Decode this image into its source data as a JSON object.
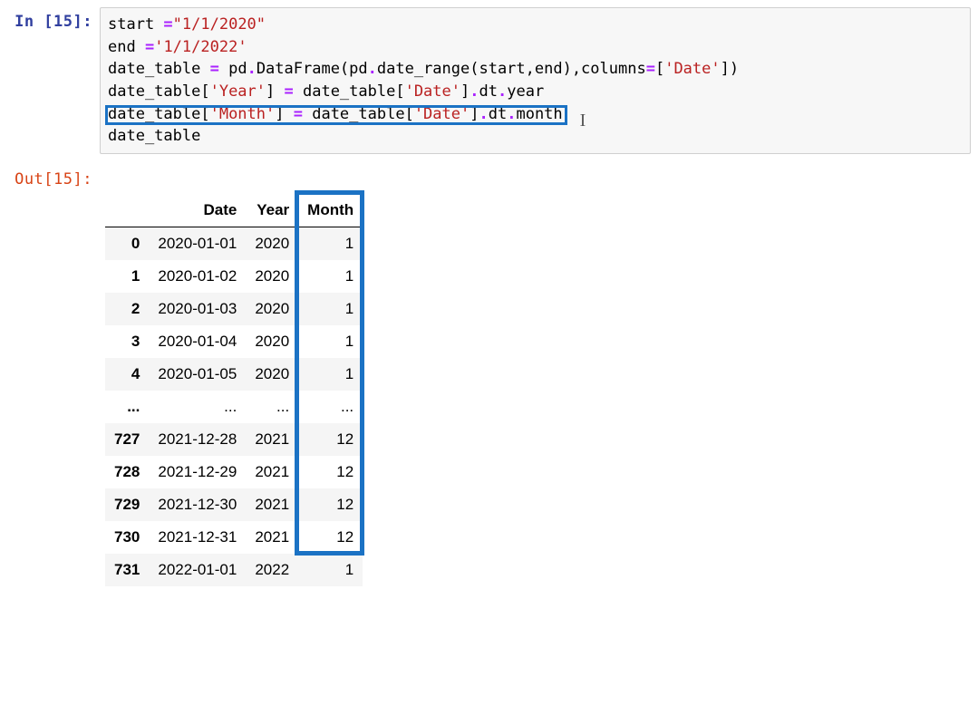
{
  "prompts": {
    "in_label": "In [",
    "in_num": "15",
    "in_close": "]:",
    "out_label": "Out[",
    "out_num": "15",
    "out_close": "]:"
  },
  "code": {
    "l1a": "start ",
    "l1b": "=",
    "l1c": "\"1/1/2020\"",
    "l2a": "end ",
    "l2b": "=",
    "l2c": "'1/1/2022'",
    "l3a": "date_table ",
    "l3b": "=",
    "l3c": " pd",
    "l3d": ".",
    "l3e": "DataFrame(pd",
    "l3f": ".",
    "l3g": "date_range(start,end),columns",
    "l3h": "=",
    "l3i": "[",
    "l3j": "'Date'",
    "l3k": "])",
    "l4a": "date_table[",
    "l4b": "'Year'",
    "l4c": "] ",
    "l4d": "=",
    "l4e": " date_table[",
    "l4f": "'Date'",
    "l4g": "]",
    "l4h": ".",
    "l4i": "dt",
    "l4j": ".",
    "l4k": "year",
    "l5a": "date_table[",
    "l5b": "'Month'",
    "l5c": "] ",
    "l5d": "=",
    "l5e": " date_table[",
    "l5f": "'Date'",
    "l5g": "]",
    "l5h": ".",
    "l5i": "dt",
    "l5j": ".",
    "l5k": "month",
    "l6": "date_table"
  },
  "table": {
    "columns": [
      "Date",
      "Year",
      "Month"
    ],
    "rows": [
      {
        "idx": "0",
        "date": "2020-01-01",
        "year": "2020",
        "month": "1"
      },
      {
        "idx": "1",
        "date": "2020-01-02",
        "year": "2020",
        "month": "1"
      },
      {
        "idx": "2",
        "date": "2020-01-03",
        "year": "2020",
        "month": "1"
      },
      {
        "idx": "3",
        "date": "2020-01-04",
        "year": "2020",
        "month": "1"
      },
      {
        "idx": "4",
        "date": "2020-01-05",
        "year": "2020",
        "month": "1"
      },
      {
        "idx": "...",
        "date": "...",
        "year": "...",
        "month": "..."
      },
      {
        "idx": "727",
        "date": "2021-12-28",
        "year": "2021",
        "month": "12"
      },
      {
        "idx": "728",
        "date": "2021-12-29",
        "year": "2021",
        "month": "12"
      },
      {
        "idx": "729",
        "date": "2021-12-30",
        "year": "2021",
        "month": "12"
      },
      {
        "idx": "730",
        "date": "2021-12-31",
        "year": "2021",
        "month": "12"
      },
      {
        "idx": "731",
        "date": "2022-01-01",
        "year": "2022",
        "month": "1"
      }
    ]
  },
  "highlights": {
    "code_box_target": "code-line-5",
    "month_column": "Month"
  }
}
